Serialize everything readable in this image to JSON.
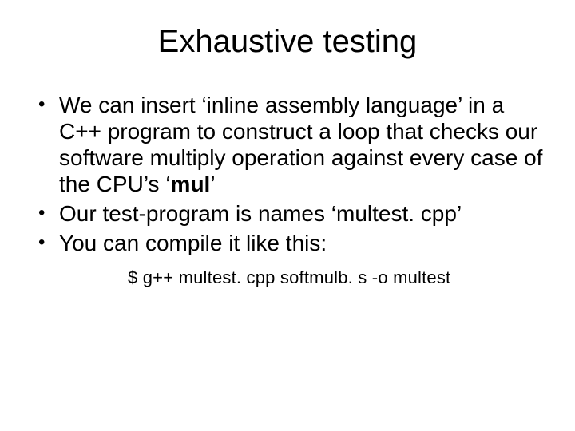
{
  "slide": {
    "title": "Exhaustive testing",
    "bullet1_pre": "We can insert ‘inline assembly language’ in a C++ program to construct a loop that checks our software multiply operation against every case of the CPU’s ‘",
    "bullet1_bold": "mul",
    "bullet1_post": "’",
    "bullet2": "Our test-program is names ‘multest. cpp’",
    "bullet3": "You can compile it like this:",
    "command": "$  g++  multest. cpp  softmulb. s  -o  multest"
  }
}
